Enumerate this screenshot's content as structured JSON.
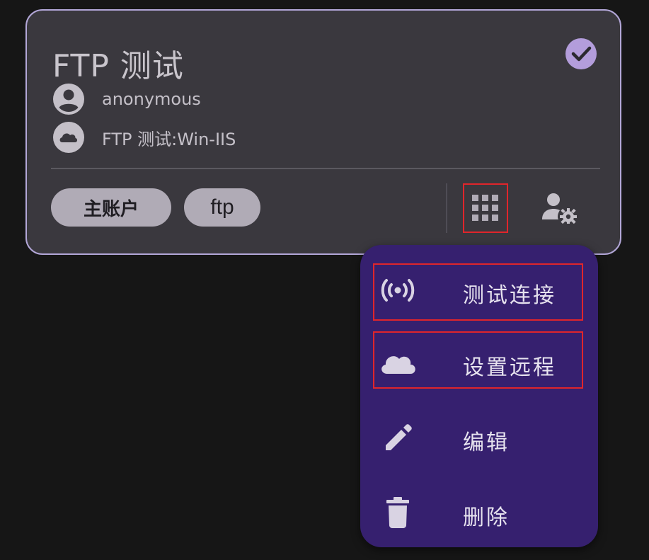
{
  "card": {
    "title": "FTP 测试",
    "user": "anonymous",
    "remote": "FTP 测试:Win-IIS",
    "chips": [
      "主账户",
      "ftp"
    ]
  },
  "menu": {
    "items": [
      {
        "label": "测试连接",
        "icon": "wifi-tethering-icon"
      },
      {
        "label": "设置远程",
        "icon": "cloud-icon"
      },
      {
        "label": "编辑",
        "icon": "pencil-icon"
      },
      {
        "label": "删除",
        "icon": "trash-icon"
      }
    ]
  },
  "colors": {
    "background": "#161616",
    "card": "#3a383e",
    "card_border": "#b3a7d8",
    "accent": "#b39ddb",
    "menu_bg": "#36206f",
    "highlight": "#e0252b"
  }
}
